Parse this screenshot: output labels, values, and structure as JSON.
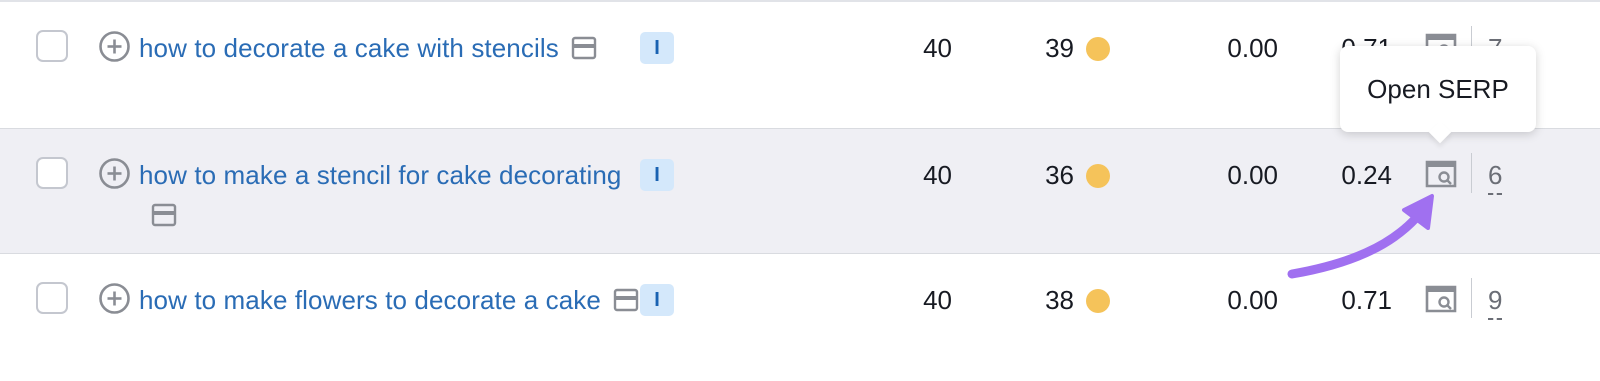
{
  "rows": [
    {
      "keyword": "how to decorate a cake with stencils",
      "intent": "I",
      "volume": "40",
      "kd": "39",
      "cpc": "0.00",
      "competition": "0.71",
      "results": "7"
    },
    {
      "keyword": "how to make a stencil for cake decorating",
      "intent": "I",
      "volume": "40",
      "kd": "36",
      "cpc": "0.00",
      "competition": "0.24",
      "results": "6"
    },
    {
      "keyword": "how to make flowers to decorate a cake",
      "intent": "I",
      "volume": "40",
      "kd": "38",
      "cpc": "0.00",
      "competition": "0.71",
      "results": "9"
    }
  ],
  "tooltip": {
    "text": "Open SERP"
  },
  "colors": {
    "link": "#2a6cb5",
    "kd_dot": "#f5c35a",
    "intent_bg": "#d4e8fb",
    "highlight_row": "#efeff4",
    "arrow": "#a070f0"
  },
  "icons": {
    "add": "plus-circle-icon",
    "serp_features": "serp-features-icon",
    "serp": "serp-preview-icon",
    "arrow": "annotation-arrow"
  }
}
